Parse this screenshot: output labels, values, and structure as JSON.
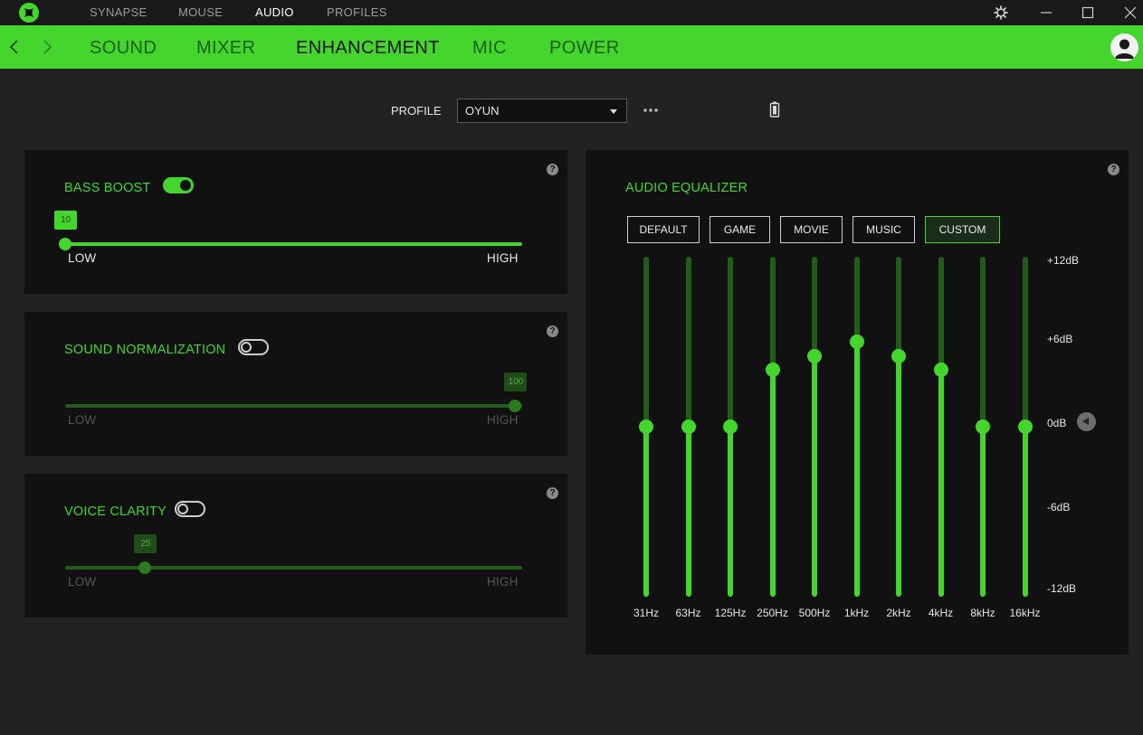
{
  "colors": {
    "accent": "#44d62c",
    "background": "#222222",
    "panel": "#111111"
  },
  "topnav": {
    "items": [
      "SYNAPSE",
      "MOUSE",
      "AUDIO",
      "PROFILES"
    ],
    "active": "AUDIO"
  },
  "subnav": {
    "items": [
      "SOUND",
      "MIXER",
      "ENHANCEMENT",
      "MIC",
      "POWER"
    ],
    "active": "ENHANCEMENT"
  },
  "profile": {
    "label": "PROFILE",
    "selected": "OYUN"
  },
  "bass_boost": {
    "title": "BASS BOOST",
    "enabled": true,
    "value": "10",
    "fraction": 0.0,
    "low": "LOW",
    "high": "HIGH"
  },
  "sound_normalization": {
    "title": "SOUND NORMALIZATION",
    "enabled": false,
    "value": "100",
    "fraction": 0.985,
    "low": "LOW",
    "high": "HIGH"
  },
  "voice_clarity": {
    "title": "VOICE CLARITY",
    "enabled": false,
    "value": "25",
    "fraction": 0.175,
    "low": "LOW",
    "high": "HIGH"
  },
  "equalizer": {
    "title": "AUDIO EQUALIZER",
    "presets": [
      "DEFAULT",
      "GAME",
      "MOVIE",
      "MUSIC",
      "CUSTOM"
    ],
    "active_preset": "CUSTOM",
    "db_labels": [
      "+12dB",
      "+6dB",
      "0dB",
      "-6dB",
      "-12dB"
    ],
    "db_range": [
      -12,
      12
    ],
    "bands": [
      {
        "freq": "31Hz",
        "gain": 0
      },
      {
        "freq": "63Hz",
        "gain": 0
      },
      {
        "freq": "125Hz",
        "gain": 0
      },
      {
        "freq": "250Hz",
        "gain": 4
      },
      {
        "freq": "500Hz",
        "gain": 5
      },
      {
        "freq": "1kHz",
        "gain": 6
      },
      {
        "freq": "2kHz",
        "gain": 5
      },
      {
        "freq": "4kHz",
        "gain": 4
      },
      {
        "freq": "8kHz",
        "gain": 0
      },
      {
        "freq": "16kHz",
        "gain": 0
      }
    ]
  },
  "icons": {
    "logo": "razer-logo-icon",
    "settings": "gear-icon",
    "minimize": "minimize-icon",
    "maximize": "maximize-icon",
    "close": "close-icon",
    "back": "chevron-left-icon",
    "forward": "chevron-right-icon",
    "user": "user-avatar-icon",
    "more": "more-dots-icon",
    "battery": "battery-icon",
    "help": "help-icon",
    "reset": "reset-arrow-icon"
  }
}
